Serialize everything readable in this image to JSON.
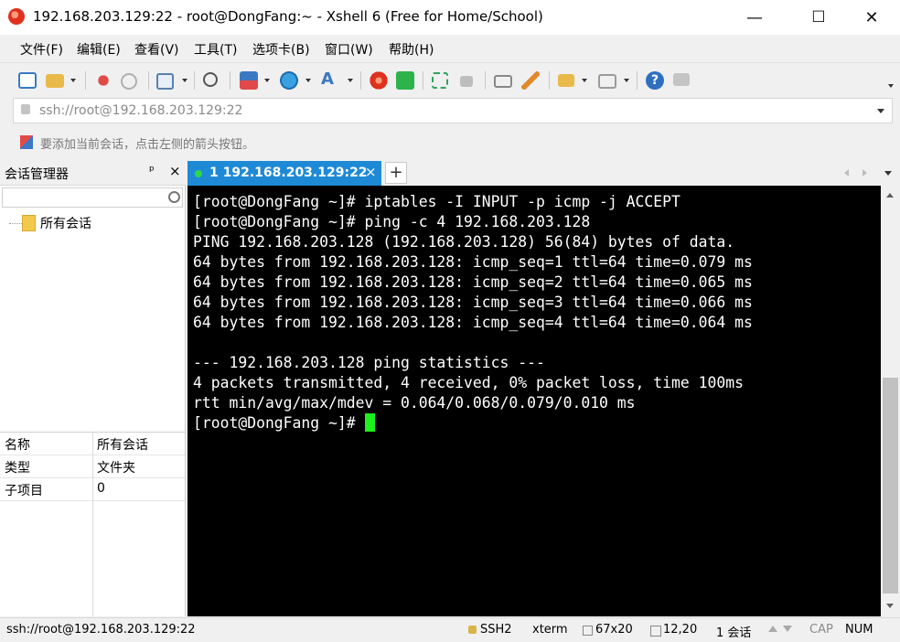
{
  "window": {
    "title": "192.168.203.129:22 - root@DongFang:~ - Xshell 6 (Free for Home/School)",
    "minimize": "—",
    "maximize": "☐",
    "close": "✕"
  },
  "menu": [
    "文件(F)",
    "编辑(E)",
    "查看(V)",
    "工具(T)",
    "选项卡(B)",
    "窗口(W)",
    "帮助(H)"
  ],
  "address": {
    "value": "ssh://root@192.168.203.129:22"
  },
  "hint": "要添加当前会话，点击左侧的箭头按钮。",
  "session_manager": {
    "title": "会话管理器",
    "pin": "ᵖ",
    "close": "×",
    "tree_item": "所有会话",
    "properties": [
      {
        "key": "名称",
        "value": "所有会话"
      },
      {
        "key": "类型",
        "value": "文件夹"
      },
      {
        "key": "子项目",
        "value": "0"
      }
    ]
  },
  "tab": {
    "label": "1 192.168.203.129:22",
    "close": "×",
    "add": "+"
  },
  "terminal": {
    "lines": [
      "[root@DongFang ~]# iptables -I INPUT -p icmp -j ACCEPT",
      "[root@DongFang ~]# ping -c 4 192.168.203.128",
      "PING 192.168.203.128 (192.168.203.128) 56(84) bytes of data.",
      "64 bytes from 192.168.203.128: icmp_seq=1 ttl=64 time=0.079 ms",
      "64 bytes from 192.168.203.128: icmp_seq=2 ttl=64 time=0.065 ms",
      "64 bytes from 192.168.203.128: icmp_seq=3 ttl=64 time=0.066 ms",
      "64 bytes from 192.168.203.128: icmp_seq=4 ttl=64 time=0.064 ms",
      "",
      "--- 192.168.203.128 ping statistics ---",
      "4 packets transmitted, 4 received, 0% packet loss, time 100ms",
      "rtt min/avg/max/mdev = 0.064/0.068/0.079/0.010 ms"
    ],
    "prompt": "[root@DongFang ~]# ",
    "cursor_color": "#1df01d"
  },
  "status": {
    "connection": "ssh://root@192.168.203.129:22",
    "protocol": "SSH2",
    "term_type": "xterm",
    "size": "67x20",
    "position": "12,20",
    "sessions": "1 会话",
    "cap": "CAP",
    "num": "NUM"
  },
  "colors": {
    "tab_active": "#1e8ad6",
    "terminal_bg": "#000000",
    "terminal_fg": "#ffffff"
  }
}
